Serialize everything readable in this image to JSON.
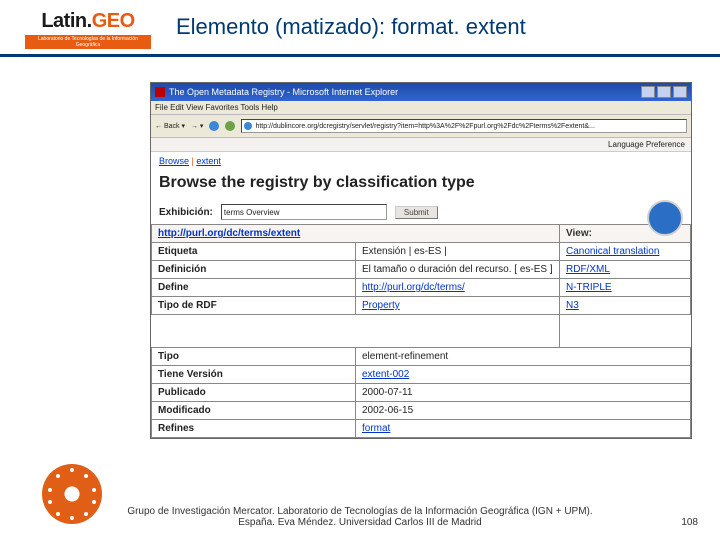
{
  "header": {
    "logo_main1": "Latin.",
    "logo_main2": "GEO",
    "logo_sub": "Laboratorio de Tecnologías de la Información Geográfica",
    "title": "Elemento (matizado): format. extent"
  },
  "browser": {
    "window_title": "The Open Metadata Registry - Microsoft Internet Explorer",
    "menu": "File  Edit  View  Favorites  Tools  Help",
    "nav_back": "← Back ▾",
    "nav_fwd": "→ ▾",
    "address_url": "http://dublincore.org/dcregistry/servlet/registry?item=http%3A%2F%2Fpurl.org%2Fdc%2Fterms%2Fextent&...",
    "lang_pref": "Language Preference",
    "crumb_browse": "Browse",
    "crumb_sep": " | ",
    "crumb_extent": "extent",
    "page_heading": "Browse the registry by classification type",
    "exhib_label": "Exhibición:",
    "exhib_value": "terms Overview",
    "exhib_go": "Submit"
  },
  "table": {
    "head_url": "http://purl.org/dc/terms/extent",
    "head_view": "View:",
    "rows": [
      {
        "k": "Etiqueta",
        "v": "Extensión | es-ES |",
        "view": "Canonical translation",
        "vlink": false,
        "viewlink": true
      },
      {
        "k": "Definición",
        "v": "El tamaño o duración del recurso. [ es-ES ]",
        "view": "RDF/XML",
        "vlink": false,
        "viewlink": true
      },
      {
        "k": "Define",
        "v": "http://purl.org/dc/terms/",
        "view": "N-TRIPLE",
        "vlink": true,
        "viewlink": true
      },
      {
        "k": "Tipo de RDF",
        "v": "Property",
        "view": "N3",
        "vlink": true,
        "viewlink": true
      }
    ],
    "rows2": [
      {
        "k": "Tipo",
        "v": "element-refinement"
      },
      {
        "k": "Tiene Versión",
        "v": "extent-002",
        "vlink": true
      },
      {
        "k": "Publicado",
        "v": "2000-07-11"
      },
      {
        "k": "Modificado",
        "v": "2002-06-15"
      },
      {
        "k": "Refines",
        "v": "format",
        "vlink": true
      }
    ]
  },
  "footer": {
    "line1": "Grupo de Investigación Mercator. Laboratorio de Tecnologías de la Información Geográfica (IGN + UPM).",
    "line2": "España. Eva Méndez. Universidad Carlos III de Madrid",
    "slide_num": "108"
  }
}
